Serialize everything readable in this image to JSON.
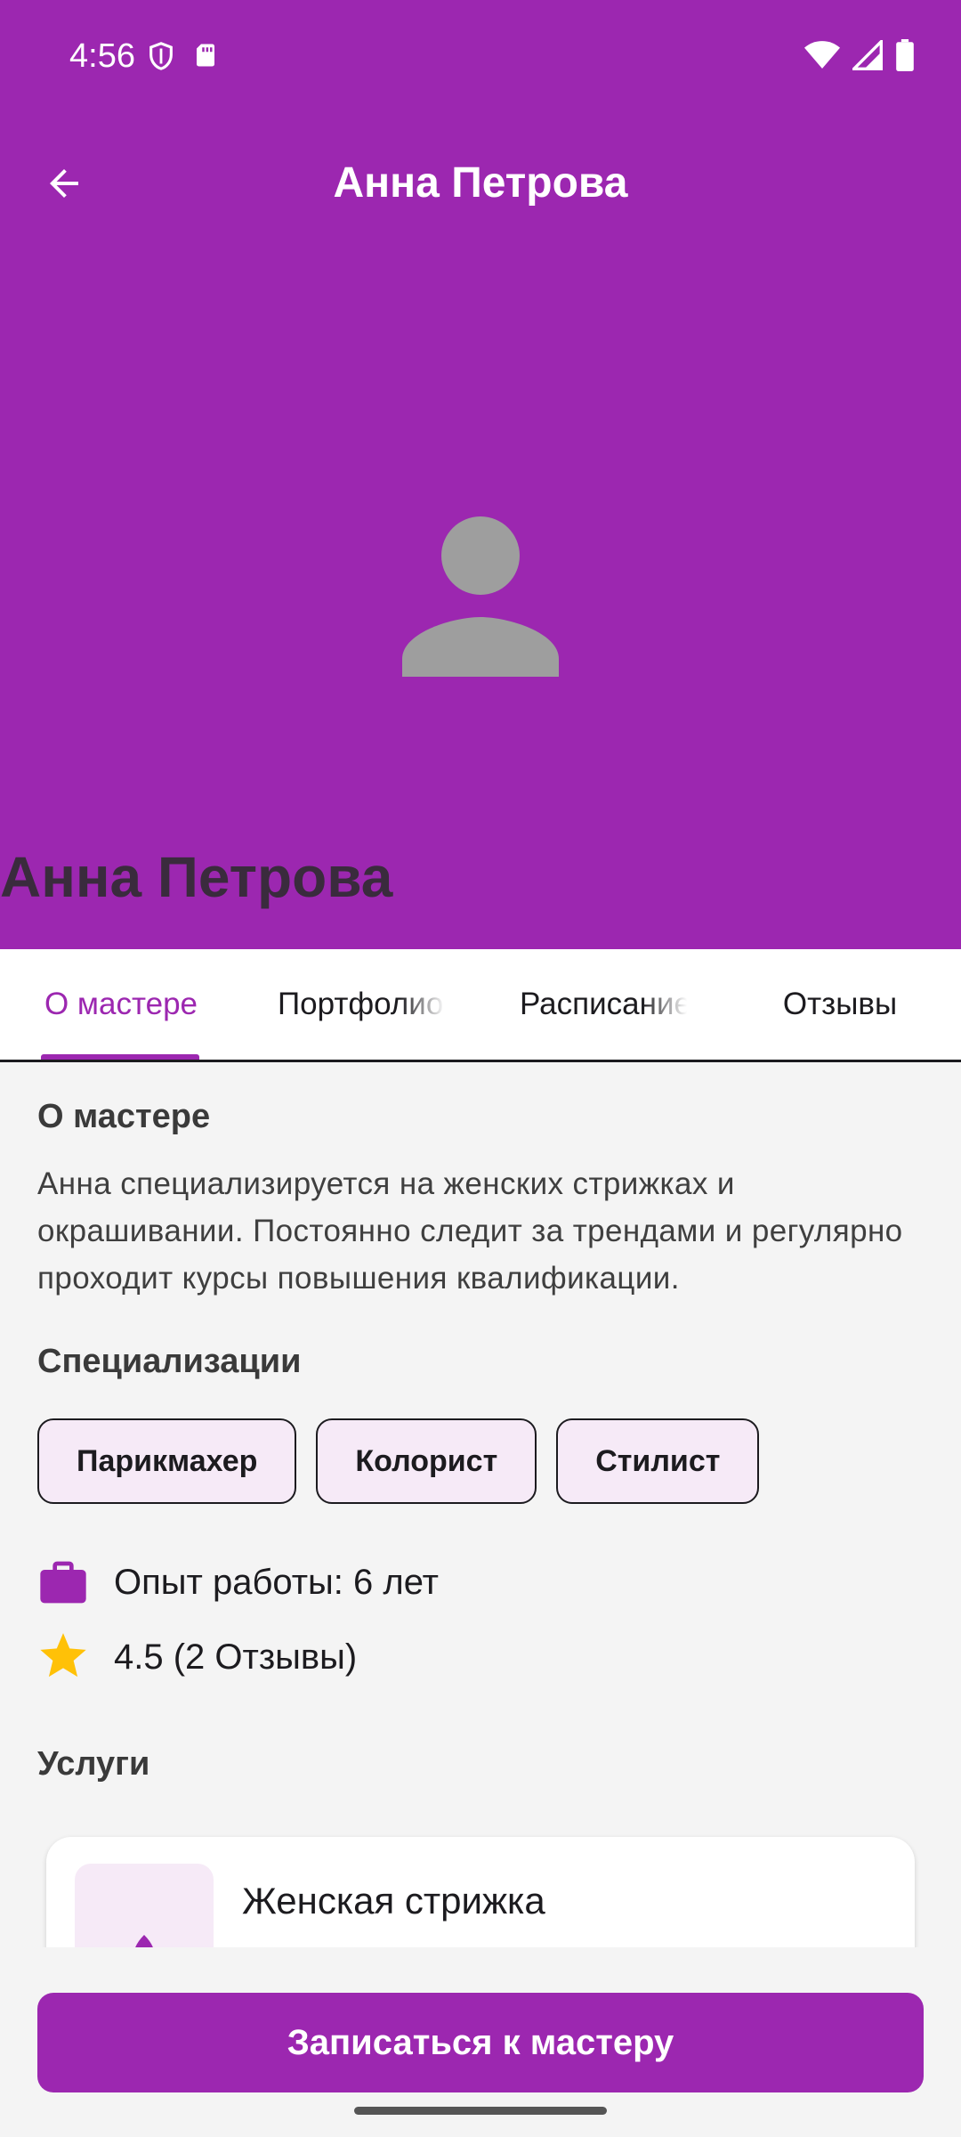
{
  "status_bar": {
    "time": "4:56",
    "icons_left": [
      "shield-icon",
      "sd-card-icon"
    ],
    "icons_right": [
      "wifi-icon",
      "signal-icon",
      "battery-icon"
    ]
  },
  "header": {
    "title": "Анна Петрова",
    "back_icon": "arrow-back-icon"
  },
  "hero": {
    "avatar_icon": "person-icon",
    "name": "Анна Петрова"
  },
  "tabs": [
    {
      "label": "О мастере",
      "active": true
    },
    {
      "label": "Портфолио",
      "active": false
    },
    {
      "label": "Расписание",
      "active": false
    },
    {
      "label": "Отзывы",
      "active": false
    }
  ],
  "about": {
    "title": "О мастере",
    "text": "Анна специализируется на женских стрижках и окрашивании. Постоянно следит за трендами и регулярно проходит курсы повышения квалификации."
  },
  "specializations": {
    "title": "Специализации",
    "chips": [
      "Парикмахер",
      "Колорист",
      "Стилист"
    ]
  },
  "experience": {
    "icon": "briefcase-icon",
    "text": "Опыт работы: 6 лет"
  },
  "rating": {
    "icon": "star-icon",
    "text": "4.5 (2 Отзывы)"
  },
  "services": {
    "title": "Услуги",
    "items": [
      {
        "name": "Женская стрижка",
        "icon": "spa-icon"
      }
    ]
  },
  "cta": {
    "label": "Записаться к мастеру"
  },
  "colors": {
    "primary": "#9c27b0",
    "chip_bg": "#f6eaf7",
    "star": "#ffc107",
    "avatar": "#9e9e9e"
  }
}
